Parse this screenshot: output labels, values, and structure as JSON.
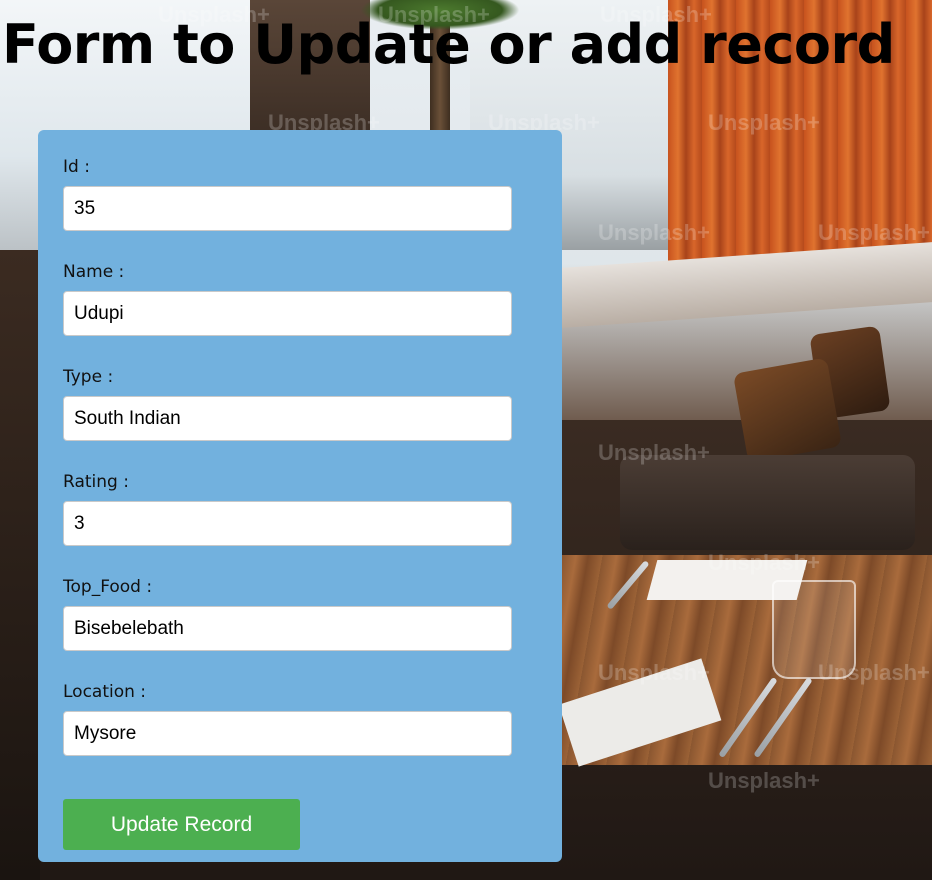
{
  "page": {
    "title": "Form to Update or add record"
  },
  "background": {
    "watermark": "Unsplash+"
  },
  "form": {
    "fields": [
      {
        "label": "Id :",
        "value": "35"
      },
      {
        "label": "Name :",
        "value": "Udupi"
      },
      {
        "label": "Type :",
        "value": "South Indian"
      },
      {
        "label": "Rating :",
        "value": "3"
      },
      {
        "label": "Top_Food :",
        "value": "Bisebelebath"
      },
      {
        "label": "Location :",
        "value": "Mysore"
      }
    ],
    "submit_label": "Update Record"
  },
  "colors": {
    "card_background": "#72b1de",
    "button_background": "#4caf50",
    "button_text": "#ffffff",
    "title_text": "#000000"
  }
}
